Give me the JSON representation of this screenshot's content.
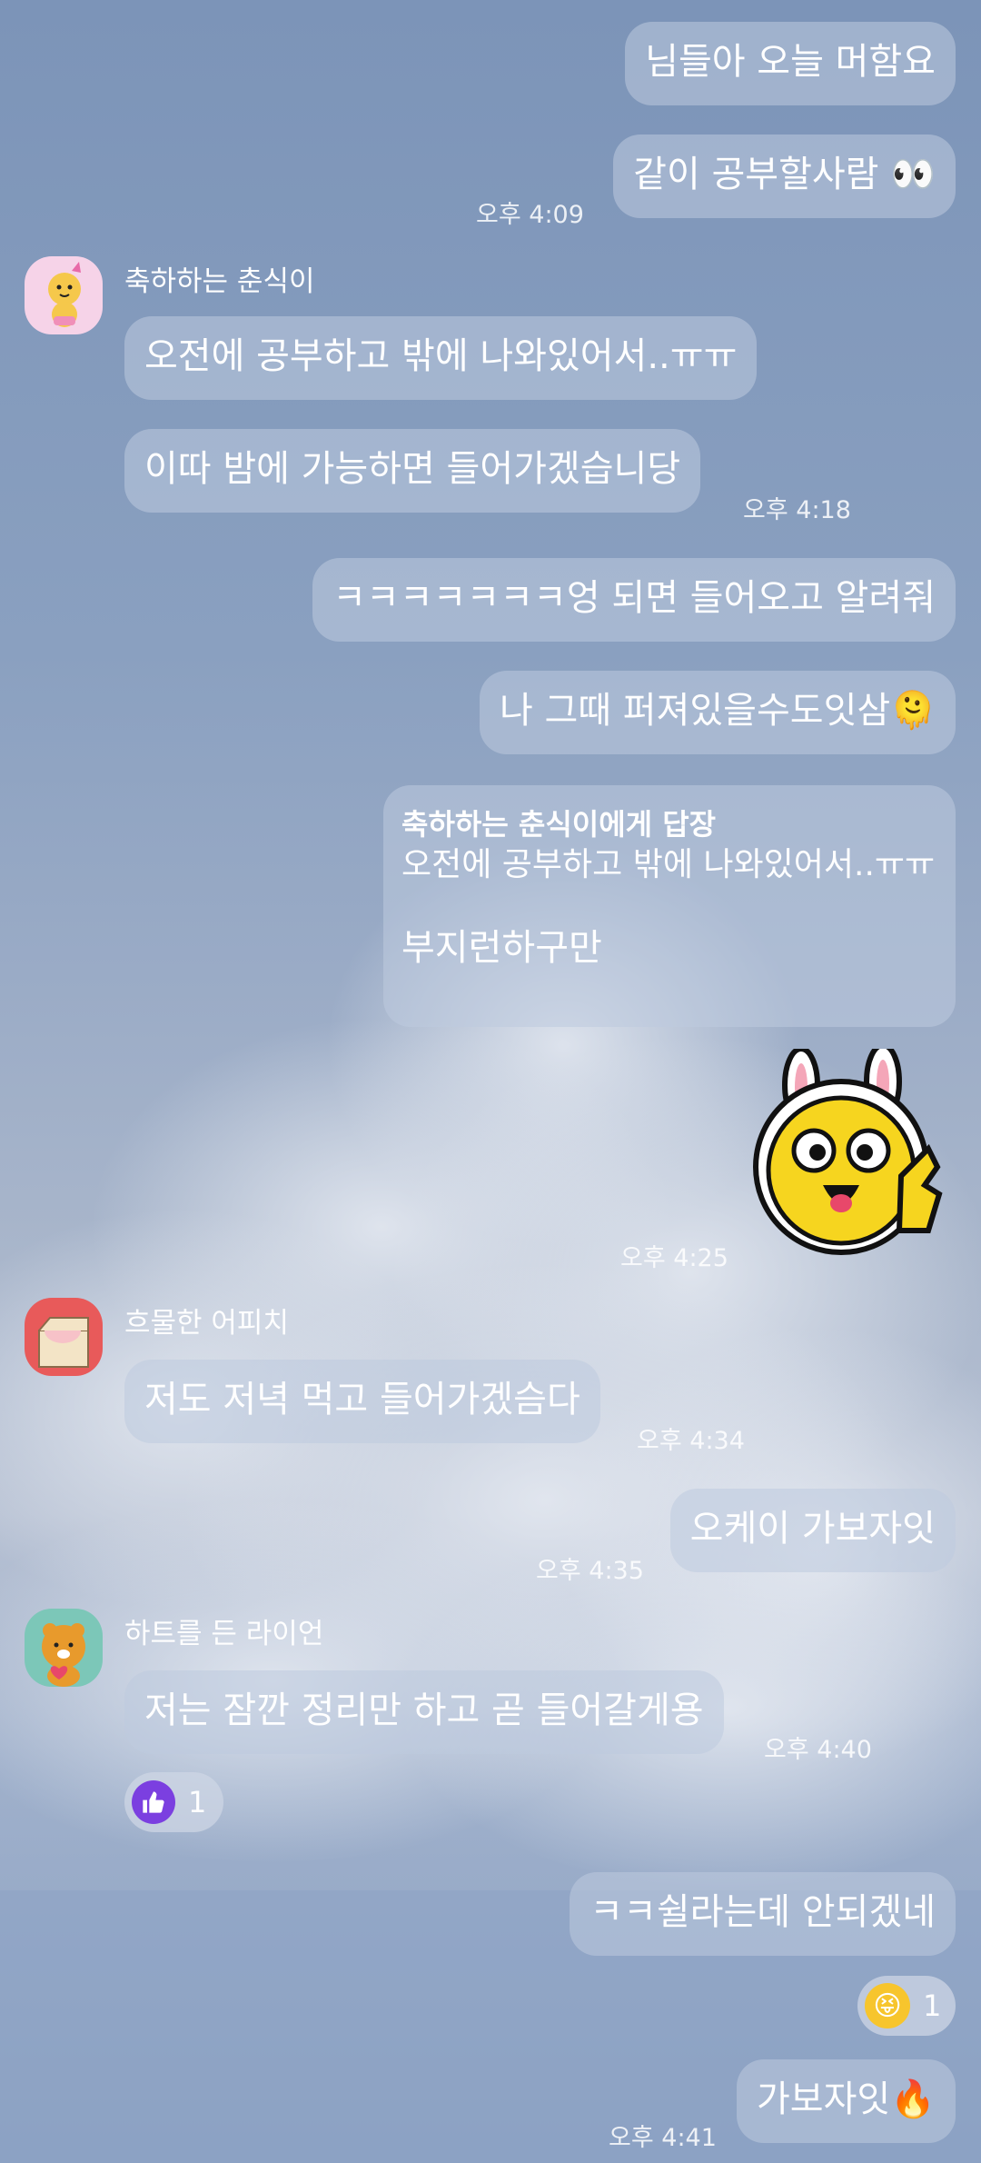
{
  "messages": {
    "m1": {
      "text": "님들아 오늘 머함요"
    },
    "m2": {
      "text": "같이 공부할사람 👀",
      "time": "오후 4:09"
    },
    "u1": {
      "name": "축하하는 춘식이",
      "m1": "오전에 공부하고 밖에 나와있어서..ㅠㅠ",
      "m2": "이따 밤에 가능하면 들어가겠습니당",
      "time": "오후 4:18"
    },
    "m3": {
      "text": "ㅋㅋㅋㅋㅋㅋㅋ엉 되면 들어오고 알려줘"
    },
    "m4": {
      "text": "나 그때 퍼져있을수도잇삼🫠"
    },
    "reply": {
      "title": "축하하는 춘식이에게 답장",
      "quote": "오전에 공부하고 밖에 나와있어서..ㅠㅠ",
      "text": "부지런하구만"
    },
    "sticker": {
      "time": "오후 4:25",
      "icon": "ryan-bunny-thumbs-up-sticker"
    },
    "u2": {
      "name": "흐물한 어피치",
      "m1": "저도 저녁 먹고 들어가겠슴다",
      "time": "오후 4:34"
    },
    "m5": {
      "text": "오케이 가보자잇",
      "time": "오후 4:35"
    },
    "u3": {
      "name": "하트를 든 라이언",
      "m1": "저는 잠깐 정리만 하고 곧 들어갈게용",
      "time": "오후 4:40",
      "reaction_count": "1"
    },
    "m6": {
      "text": "ㅋㅋ쉴라는데 안되겠네",
      "reaction_count": "1"
    },
    "m7": {
      "text": "가보자잇🔥",
      "time": "오후 4:41"
    }
  },
  "colors": {
    "bubble": "#bccbdf",
    "reaction_like": "#7b3fe0"
  }
}
